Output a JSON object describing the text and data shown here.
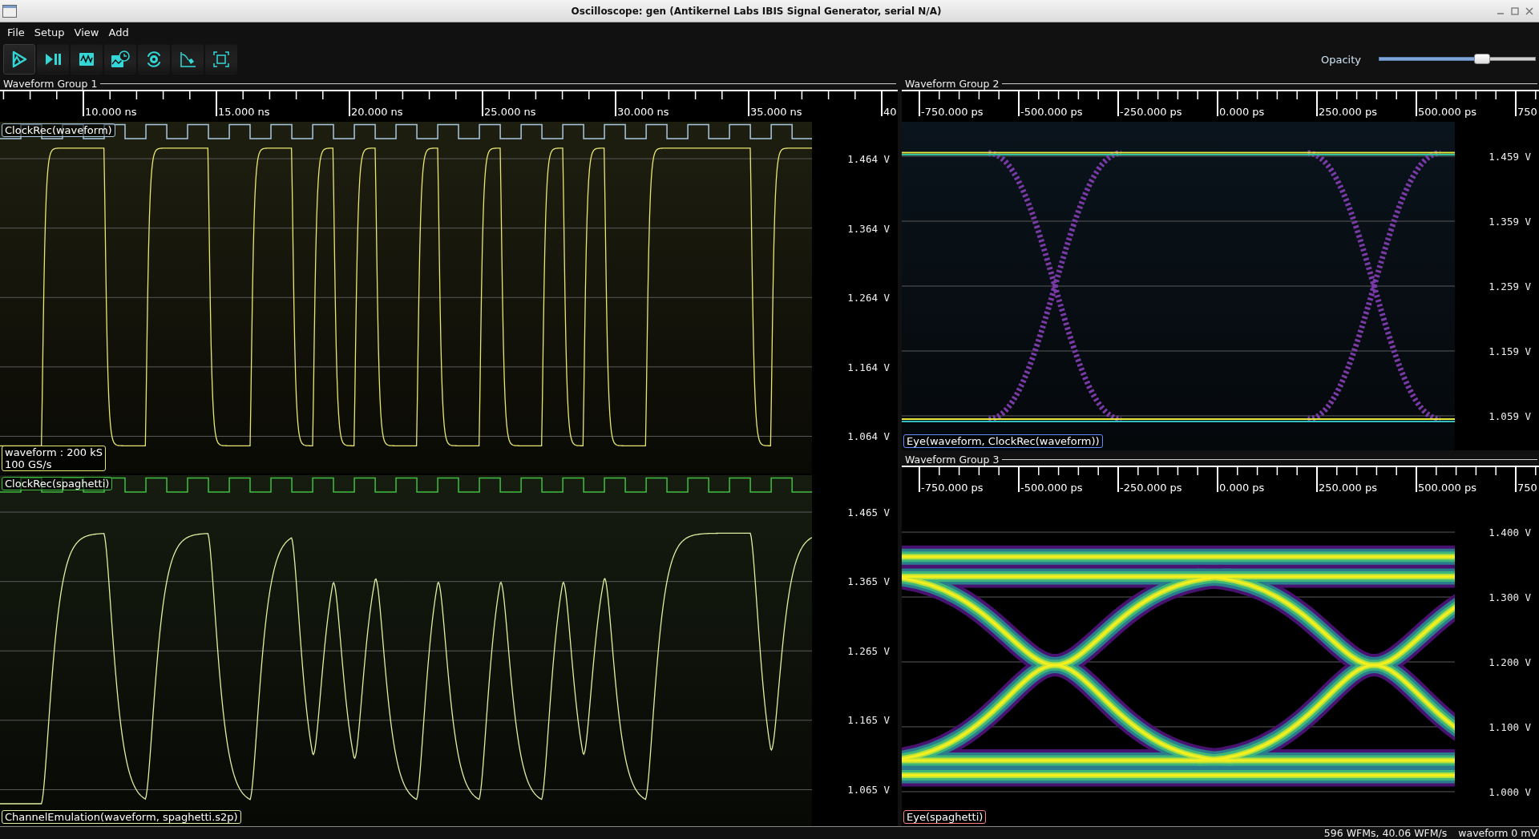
{
  "window": {
    "title": "Oscilloscope: gen (Antikernel Labs IBIS Signal Generator, serial N/A)"
  },
  "menu": [
    {
      "label": "File"
    },
    {
      "label": "Setup"
    },
    {
      "label": "View"
    },
    {
      "label": "Add"
    }
  ],
  "toolbar": [
    {
      "kind": "start",
      "selected": true
    },
    {
      "kind": "single",
      "selected": false
    },
    {
      "kind": "waveform",
      "selected": false
    },
    {
      "kind": "history",
      "selected": false
    },
    {
      "kind": "refresh",
      "selected": false
    },
    {
      "kind": "measure",
      "selected": false
    },
    {
      "kind": "fullscreen",
      "selected": false
    }
  ],
  "opacity": {
    "label": "Opacity",
    "level": 0.66
  },
  "groups": [
    {
      "title": "Waveform Group 1",
      "ruler": [
        "10.000 ns",
        "15.000 ns",
        "20.000 ns",
        "25.000 ns",
        "30.000 ns",
        "35.000 ns",
        "40"
      ],
      "panels": [
        {
          "kind": "waveform",
          "clock": {
            "label": "ClockRec(waveform)",
            "color": "#a8c8e0"
          },
          "trace": {
            "lines": [
              "waveform : 200 kS",
              "100 GS/s"
            ],
            "color": "#e8e870"
          },
          "yticks": [
            "1.464 V",
            "1.364 V",
            "1.264 V",
            "1.164 V",
            "1.064 V"
          ]
        },
        {
          "kind": "channel",
          "clock": {
            "label": "ClockRec(spaghetti)",
            "color": "#40c040"
          },
          "trace": {
            "lines": [
              "ChannelEmulation(waveform, spaghetti.s2p)"
            ],
            "color": "#e0f0a0"
          },
          "yticks": [
            "1.465 V",
            "1.365 V",
            "1.265 V",
            "1.165 V",
            "1.065 V"
          ]
        }
      ]
    },
    {
      "title": "Waveform Group 2",
      "ruler": [
        "-750.000 ps",
        "-500.000 ps",
        "-250.000 ps",
        "0.000 ps",
        "250.000 ps",
        "500.000 ps",
        "750"
      ],
      "panels": [
        {
          "kind": "eye",
          "trace": {
            "lines": [
              "Eye(waveform, ClockRec(waveform))"
            ],
            "color": "#6090ff"
          },
          "yticks": [
            "1.459 V",
            "1.359 V",
            "1.259 V",
            "1.159 V",
            "1.059 V"
          ]
        }
      ]
    },
    {
      "title": "Waveform Group 3",
      "ruler": [
        "-750.000 ps",
        "-500.000 ps",
        "-250.000 ps",
        "0.000 ps",
        "250.000 ps",
        "500.000 ps",
        "750"
      ],
      "panels": [
        {
          "kind": "density",
          "trace": {
            "lines": [
              "Eye(spaghetti)"
            ],
            "color": "#ff8080"
          },
          "yticks": [
            "1.400 V",
            "1.300 V",
            "1.200 V",
            "1.100 V",
            "1.000 V"
          ]
        }
      ]
    }
  ],
  "status": [
    "596 WFMs, 40.06 WFM/s",
    "waveform 0 mV"
  ]
}
